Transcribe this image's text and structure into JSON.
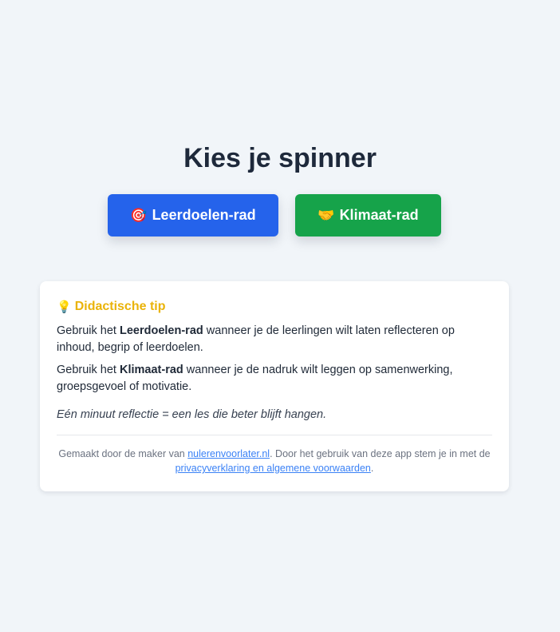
{
  "page": {
    "title": "Kies je spinner"
  },
  "buttons": {
    "leer": {
      "emoji": "🎯",
      "label": "Leerdoelen-rad",
      "color": "#2563eb"
    },
    "klimaat": {
      "emoji": "🤝",
      "label": "Klimaat-rad",
      "color": "#16a34a"
    }
  },
  "tip": {
    "icon": "💡",
    "icon_name": "lightbulb-icon",
    "title": "Didactische tip",
    "title_color": "#eab308",
    "p1": {
      "prefix": "Gebruik het ",
      "bold": "Leerdoelen-rad",
      "suffix": " wanneer je de leerlingen wilt laten reflecteren op inhoud, begrip of leerdoelen."
    },
    "p2": {
      "prefix": "Gebruik het ",
      "bold": "Klimaat-rad",
      "suffix": " wanneer je de nadruk wilt leggen op samenwerking, groepsgevoel of motivatie."
    },
    "quote": "Eén minuut reflectie = een les die beter blijft hangen."
  },
  "footer": {
    "text1": "Gemaakt door de maker van ",
    "link1": "nulerenvoorlater.nl",
    "text2": ". Door het gebruik van deze app stem je in met de ",
    "link2": "privacyverklaring en algemene voorwaarden",
    "text3": "."
  }
}
